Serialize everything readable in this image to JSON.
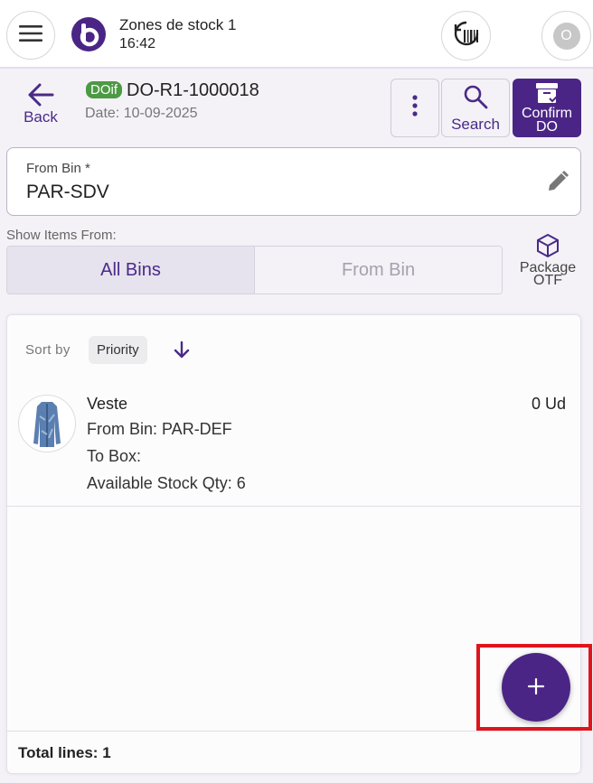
{
  "header": {
    "store_name": "Zones de stock 1",
    "time": "16:42",
    "avatar_initial": "O"
  },
  "toolbar": {
    "back_label": "Back",
    "do_badge": "DOif",
    "do_number": "DO-R1-1000018",
    "date": "Date: 10-09-2025",
    "search_label": "Search",
    "confirm_line1": "Confirm",
    "confirm_line2": "DO"
  },
  "from_bin": {
    "label": "From Bin *",
    "value": "PAR-SDV"
  },
  "show_items": {
    "label": "Show Items From:",
    "options": [
      "All Bins",
      "From Bin"
    ],
    "selected": "All Bins"
  },
  "package": {
    "line1": "Package",
    "line2": "OTF"
  },
  "list": {
    "sort_label": "Sort by",
    "sort_value": "Priority",
    "items": [
      {
        "name": "Veste",
        "qty": "0 Ud",
        "from_bin": "From Bin: PAR-DEF",
        "to_box": "To Box:",
        "available": "Available Stock Qty: 6"
      }
    ],
    "total_lines": "Total lines: 1"
  },
  "colors": {
    "primary": "#4b2586",
    "badge_green": "#4c9a44",
    "highlight_red": "#e0141c"
  }
}
